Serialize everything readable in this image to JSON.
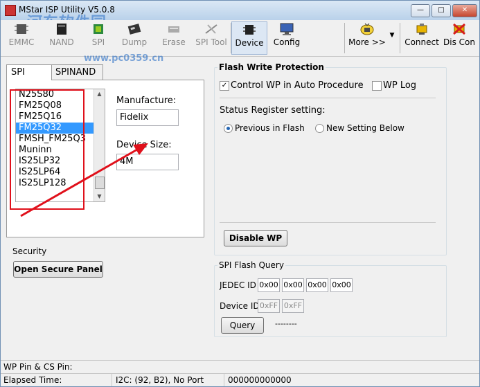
{
  "window": {
    "title": "MStar ISP Utility V5.0.8",
    "watermark": "河东软件园",
    "watermark_url": "www.pc0359.cn"
  },
  "titlebar_buttons": {
    "minimize": "—",
    "maximize": "□",
    "close": "✕"
  },
  "toolbar": {
    "items": [
      {
        "label": "EMMC",
        "icon": "chip-icon"
      },
      {
        "label": "NAND",
        "icon": "nand-chip-icon"
      },
      {
        "label": "SPI",
        "icon": "spi-chip-icon"
      },
      {
        "label": "Dump",
        "icon": "dump-icon"
      },
      {
        "label": "Erase",
        "icon": "eraser-icon"
      },
      {
        "label": "SPI Tool",
        "icon": "spi-tool-icon"
      },
      {
        "label": "Device",
        "icon": "device-icon"
      },
      {
        "label": "Config",
        "icon": "config-monitor-icon"
      },
      {
        "label": "More >>",
        "icon": "tv-icon"
      },
      {
        "label": "Connect",
        "icon": "connect-icon"
      },
      {
        "label": "Dis Con",
        "icon": "disconnect-icon"
      }
    ],
    "dropdown_glyph": "▼"
  },
  "tabs": [
    {
      "label": "SPI"
    },
    {
      "label": "SPINAND"
    }
  ],
  "device_list": {
    "items": [
      "N25S80",
      "FM25Q08",
      "FM25Q16",
      "FM25Q32",
      "FMSH_FM25Q3",
      "Muninn",
      "IS25LP32",
      "IS25LP64",
      "IS25LP128"
    ],
    "selected": "FM25Q32"
  },
  "manufacture": {
    "label": "Manufacture:",
    "value": "Fidelix"
  },
  "device_size": {
    "label": "Device Size:",
    "value": "4M"
  },
  "security": {
    "title": "Security",
    "button": "Open Secure Panel"
  },
  "flash_write_protection": {
    "title": "Flash Write Protection",
    "control_wp": {
      "label": "Control WP in Auto Procedure",
      "checked": "✓"
    },
    "wp_log": {
      "label": "WP Log"
    },
    "status_register": {
      "label": "Status Register setting:",
      "previous": "Previous in Flash",
      "new_setting": "New Setting Below"
    },
    "disable_button": "Disable WP"
  },
  "spi_flash_query": {
    "title": "SPI Flash Query",
    "jedec_label": "JEDEC ID",
    "jedec_values": [
      "0x00",
      "0x00",
      "0x00",
      "0x00"
    ],
    "device_id_label": "Device ID",
    "device_id_values": [
      "0xFF",
      "0xFF"
    ],
    "query_button": "Query",
    "result": "--------"
  },
  "status_bar": {
    "wp_pin": "WP Pin & CS Pin:",
    "elapsed": "Elapsed Time:",
    "i2c": "I2C: (92, B2), No Port",
    "counter": "000000000000"
  },
  "colors": {
    "annotation_red": "#e0101b",
    "selection_blue": "#3399ff",
    "watermark_blue": "#2a6fc6"
  }
}
